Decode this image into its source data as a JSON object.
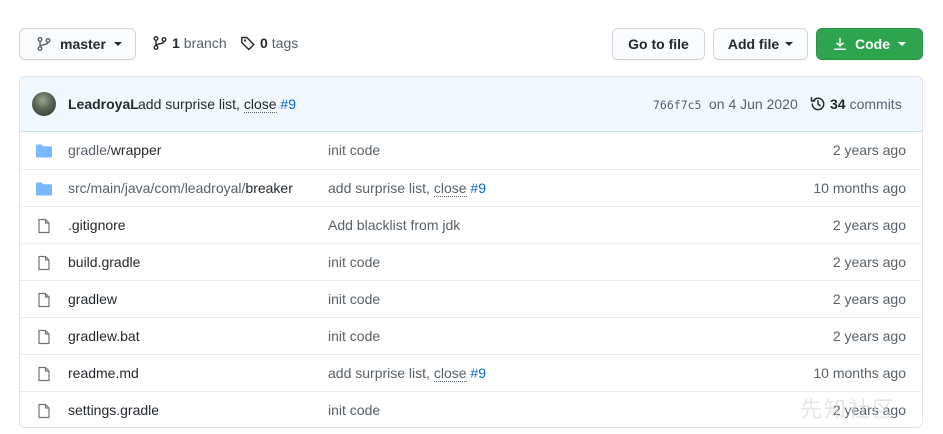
{
  "toolbar": {
    "branch": "master",
    "branch_count": "1",
    "branch_label": "branch",
    "tag_count": "0",
    "tag_label": "tags",
    "go_to_file": "Go to file",
    "add_file": "Add file",
    "code": "Code"
  },
  "commit": {
    "author": "LeadroyaL",
    "message": "add surprise list,",
    "close_word": "close",
    "issue": "#9",
    "sha": "766f7c5",
    "date": "on 4 Jun 2020",
    "commit_count": "34",
    "commit_label": "commits"
  },
  "files": [
    {
      "type": "folder",
      "name_dim": "gradle/",
      "name": "wrapper",
      "msg": "init code",
      "close": "",
      "issue": "",
      "age": "2 years ago"
    },
    {
      "type": "folder",
      "name_dim": "src/main/java/com/leadroyal/",
      "name": "breaker",
      "msg": "add surprise list,",
      "close": "close",
      "issue": "#9",
      "age": "10 months ago"
    },
    {
      "type": "file",
      "name_dim": "",
      "name": ".gitignore",
      "msg": "Add blacklist from jdk",
      "close": "",
      "issue": "",
      "age": "2 years ago"
    },
    {
      "type": "file",
      "name_dim": "",
      "name": "build.gradle",
      "msg": "init code",
      "close": "",
      "issue": "",
      "age": "2 years ago"
    },
    {
      "type": "file",
      "name_dim": "",
      "name": "gradlew",
      "msg": "init code",
      "close": "",
      "issue": "",
      "age": "2 years ago"
    },
    {
      "type": "file",
      "name_dim": "",
      "name": "gradlew.bat",
      "msg": "init code",
      "close": "",
      "issue": "",
      "age": "2 years ago"
    },
    {
      "type": "file",
      "name_dim": "",
      "name": "readme.md",
      "msg": "add surprise list,",
      "close": "close",
      "issue": "#9",
      "age": "10 months ago"
    },
    {
      "type": "file",
      "name_dim": "",
      "name": "settings.gradle",
      "msg": "init code",
      "close": "",
      "issue": "",
      "age": "2 years ago"
    }
  ],
  "watermark": "先知社区",
  "colors": {
    "folder": "#79b8ff",
    "link": "#0366d6",
    "code_button": "#2ea44f",
    "commit_bar": "#f1f8ff"
  }
}
